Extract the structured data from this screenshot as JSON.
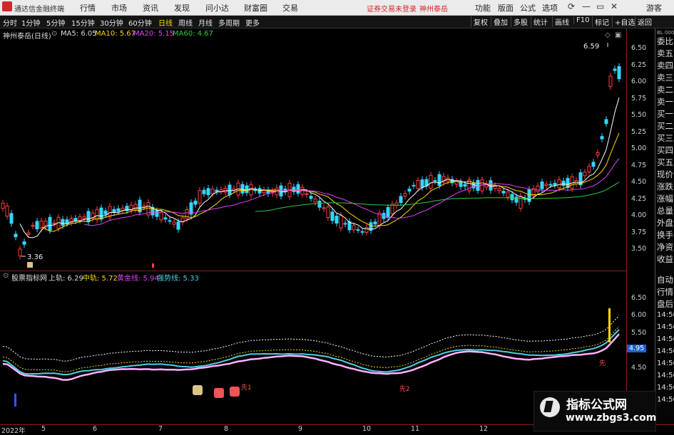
{
  "topbar": {
    "app_name": "通达信金融终端",
    "menu": [
      "行情",
      "市场",
      "资讯",
      "发现",
      "问小达",
      "财富圈",
      "交易"
    ],
    "notice": "证券交易未登录",
    "stock_name": "神州泰岳",
    "right_menu": [
      "功能",
      "版面",
      "公式",
      "选项"
    ],
    "guest": "游客",
    "window_buttons": [
      "⟳",
      "—",
      "▭",
      "✕"
    ]
  },
  "toolbar": {
    "periods": [
      "分时",
      "1分钟",
      "5分钟",
      "15分钟",
      "30分钟",
      "60分钟",
      "日线",
      "周线",
      "月线",
      "多周期",
      "更多"
    ],
    "active_period": "日线",
    "right_buttons": [
      "复权",
      "叠加",
      "多股",
      "统计",
      "画线",
      "F10",
      "标记",
      "+自选",
      "返回"
    ]
  },
  "main_legend": {
    "title": "神州泰岳(日线)",
    "ma": [
      {
        "label": "MA5: 6.05",
        "color": "#ffffff"
      },
      {
        "label": "MA10: 5.67",
        "color": "#ffd800"
      },
      {
        "label": "MA20: 5.15",
        "color": "#e040fb"
      },
      {
        "label": "MA60: 4.67",
        "color": "#2ecc40"
      }
    ]
  },
  "main_annotations": {
    "high": "6.59",
    "low": "3.36"
  },
  "main_axis": [
    "6.50",
    "6.25",
    "6.00",
    "5.75",
    "5.50",
    "5.25",
    "5.00",
    "4.75",
    "4.50",
    "4.25",
    "4.00",
    "3.75",
    "3.50"
  ],
  "sub_legend": {
    "title": "股票指标网",
    "items": [
      {
        "label": "上轨: 6.29",
        "color": "#ffffff"
      },
      {
        "label": "中轨: 5.72",
        "color": "#ffd800"
      },
      {
        "label": "黄金线: 5.94",
        "color": "#e040fb"
      },
      {
        "label": "强势线: 5.33",
        "color": "#4dd0e1"
      }
    ]
  },
  "sub_axis": [
    "6.50",
    "6.00",
    "5.50",
    "5.00",
    "4.50"
  ],
  "sub_current_value": "4.95",
  "sub_marks": [
    "先",
    "先2",
    "先1"
  ],
  "x_axis": [
    "2022年",
    "5",
    "6",
    "7",
    "8",
    "9",
    "10",
    "11",
    "12"
  ],
  "right_panel": {
    "upper": [
      "委比",
      "卖五",
      "卖四",
      "卖三",
      "卖二",
      "卖一",
      "买一",
      "买二",
      "买三",
      "买四",
      "买五",
      "现价",
      "涨跌",
      "涨幅",
      "总量",
      "外盘",
      "换手",
      "净资",
      "收益"
    ],
    "lower": [
      "自动",
      "行情",
      "盘后"
    ],
    "times": [
      "14:56",
      "14:56",
      "14:56",
      "14:56",
      "14:56",
      "14:56",
      "14:56",
      "14:56"
    ],
    "corner": "BL 000"
  },
  "watermark": {
    "line1": "指标公式网",
    "line2": "www.zbgs3.com"
  },
  "colors": {
    "up": "#ff3b3b",
    "down": "#33d6ff",
    "axis": "#8a1c1c",
    "active": "#ffd800"
  }
}
